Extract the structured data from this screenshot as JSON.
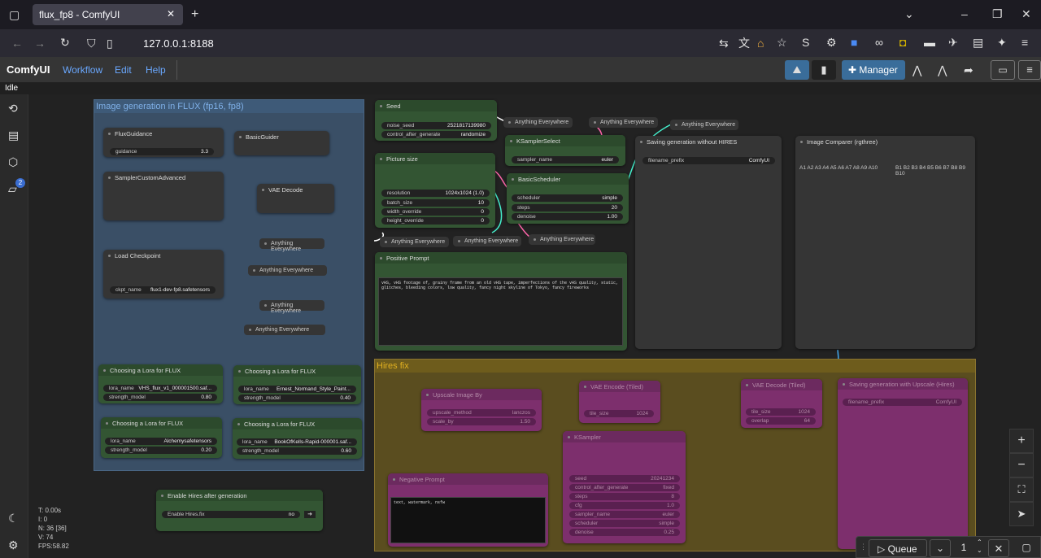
{
  "browser": {
    "tab_title": "flux_fp8 - ComfyUI",
    "url": "127.0.0.1:8188"
  },
  "menu": {
    "brand": "ComfyUI",
    "workflow": "Workflow",
    "edit": "Edit",
    "help": "Help",
    "manager": "Manager"
  },
  "status": "Idle",
  "sidebar_badge": "2",
  "stats": {
    "t": "T: 0.00s",
    "i": "I: 0",
    "n": "N: 36 [36]",
    "v": "V: 74",
    "fps": "FPS:58.82"
  },
  "queue": {
    "label": "Queue",
    "count": "1"
  },
  "groups": {
    "flux": "Image generation in FLUX (fp16, fp8)",
    "hires": "Hires fix"
  },
  "nodes": {
    "flux_guidance": {
      "title": "FluxGuidance",
      "w_label": "guidance",
      "w_value": "3.3"
    },
    "basic_guider": {
      "title": "BasicGuider"
    },
    "sampler_custom": {
      "title": "SamplerCustomAdvanced"
    },
    "vae_decode": {
      "title": "VAE Decode"
    },
    "load_checkpoint": {
      "title": "Load Checkpoint",
      "w_label": "ckpt_name",
      "w_value": "flux1-dev-fp8.safetensors"
    },
    "ae": "Anything Everywhere",
    "lora1": {
      "title": "Choosing a Lora for FLUX",
      "name": "VHS_flux_v1_000001500.saf...",
      "strength": "0.80"
    },
    "lora2": {
      "title": "Choosing a Lora for FLUX",
      "name": "Ernest_Normand_Style_Paint...",
      "strength": "0.40"
    },
    "lora3": {
      "title": "Choosing a Lora for FLUX",
      "name": "Alchemysafetensors",
      "strength": "0.20"
    },
    "lora4": {
      "title": "Choosing a Lora for FLUX",
      "name": "BookOfKells-Rapid-000001.saf...",
      "strength": "0.60"
    },
    "lora_label": "lora_name",
    "strength_label": "strength_model",
    "enable_hires": {
      "title": "Enable Hires after generation",
      "label": "Enable Hires.fix",
      "value": "no"
    },
    "seed": {
      "title": "Seed",
      "noise_label": "noise_seed",
      "noise_value": "2521817139980",
      "ctrl_label": "control_after_generate",
      "ctrl_value": "randomize"
    },
    "picture_size": {
      "title": "Picture size",
      "res_l": "resolution",
      "res_v": "1024x1024 (1.0)",
      "batch_l": "batch_size",
      "batch_v": "10",
      "w_l": "width_override",
      "w_v": "0",
      "h_l": "height_override",
      "h_v": "0"
    },
    "ksampler_select": {
      "title": "KSamplerSelect",
      "label": "sampler_name",
      "value": "euler"
    },
    "basic_scheduler": {
      "title": "BasicScheduler",
      "s_l": "scheduler",
      "s_v": "simple",
      "st_l": "steps",
      "st_v": "20",
      "d_l": "denoise",
      "d_v": "1.00"
    },
    "positive": {
      "title": "Positive Prompt",
      "text": "vHS, vHS footage of, grainy frame from an old vHS tape, imperfections of the vHS quality, static, glitches, bleeding colors, low quality, fancy night skyline of Tokyo, fancy fireworks"
    },
    "saving": {
      "title": "Saving generation without HIRES",
      "label": "filename_prefix",
      "value": "ComfyUI"
    },
    "comparer": {
      "title": "Image Comparer (rgthree)",
      "items": "A1 A2 A3 A4 A5 A6 A7 A8 A9 A10",
      "b_items": "B1 B2 B3 B4 B5 B6 B7 B8 B9 B10"
    },
    "upscale": {
      "title": "Upscale Image By",
      "m_l": "upscale_method",
      "m_v": "lanczos",
      "s_l": "scale_by",
      "s_v": "1.50"
    },
    "vae_encode": {
      "title": "VAE Encode (Tiled)",
      "l": "tile_size",
      "v": "1024"
    },
    "vae_decode_tiled": {
      "title": "VAE Decode (Tiled)",
      "l": "tile_size",
      "v": "1024",
      "o_l": "overlap",
      "o_v": "64"
    },
    "saving_hires": {
      "title": "Saving generation with Upscale (Hires)",
      "label": "filename_prefix",
      "value": "ComfyUI"
    },
    "ksampler": {
      "title": "KSampler",
      "seed_l": "seed",
      "seed_v": "20241234",
      "cag_l": "control_after_generate",
      "cag_v": "fixed",
      "steps_l": "steps",
      "steps_v": "8",
      "cfg_l": "cfg",
      "cfg_v": "1.0",
      "sn_l": "sampler_name",
      "sn_v": "euler",
      "sc_l": "scheduler",
      "sc_v": "simple",
      "dn_l": "denoise",
      "dn_v": "0.25"
    },
    "negative": {
      "title": "Negative Prompt",
      "text": "text, watermark, nsfw"
    }
  }
}
